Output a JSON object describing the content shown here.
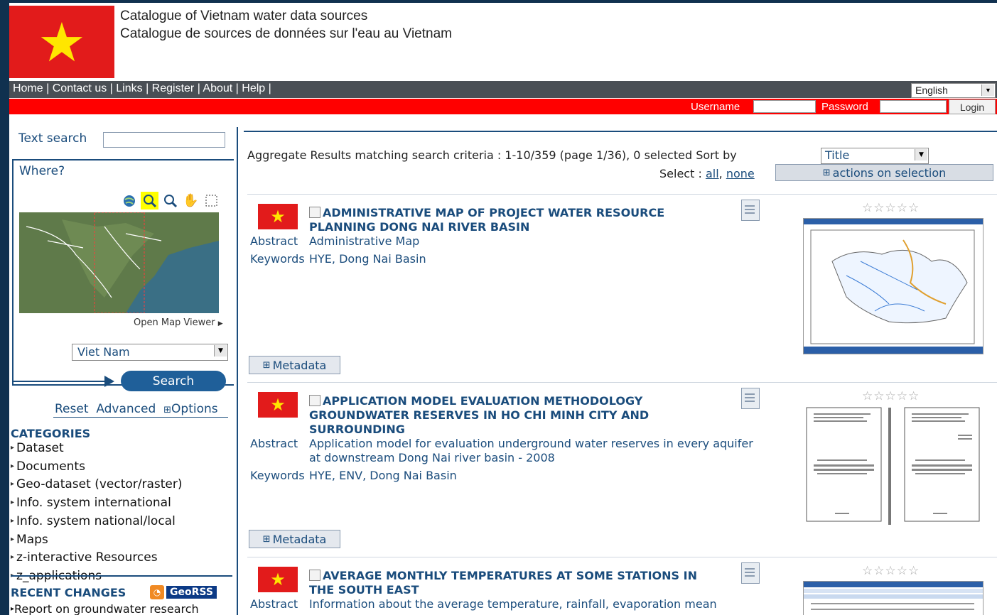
{
  "header": {
    "title_en": "Catalogue of Vietnam water data sources",
    "title_fr": "Catalogue de sources de données sur l'eau au Vietnam"
  },
  "nav": {
    "links": [
      "Home",
      "Contact us",
      "Links",
      "Register",
      "About",
      "Help"
    ],
    "language": "English"
  },
  "login": {
    "username_label": "Username",
    "password_label": "Password",
    "login_label": "Login"
  },
  "sidebar": {
    "text_search_label": "Text search",
    "where_label": "Where?",
    "open_map_viewer": "Open Map Viewer",
    "region_value": "Viet Nam",
    "search_label": "Search",
    "reset_label": "Reset",
    "advanced_label": "Advanced",
    "options_label": "Options",
    "categories_title": "CATEGORIES",
    "categories": [
      "Dataset",
      "Documents",
      "Geo-dataset (vector/raster)",
      "Info. system international",
      "Info. system national/local",
      "Maps",
      "z-interactive Resources",
      "z_applications"
    ],
    "recent_title": "RECENT CHANGES",
    "georss_label": "GeoRSS",
    "recent_item": "Report on groundwater research"
  },
  "results": {
    "aggregate_text": "Aggregate Results matching search criteria :   1-10/359   (page 1/36),   0 selected  Sort by",
    "sort_value": "Title",
    "select_label": "Select :",
    "select_all": "all",
    "select_none": "none",
    "actions_label": "actions on selection",
    "abstract_label": "Abstract",
    "keywords_label": "Keywords",
    "metadata_label": "Metadata",
    "items": [
      {
        "title": "ADMINISTRATIVE MAP OF PROJECT WATER RESOURCE PLANNING DONG NAI RIVER BASIN",
        "abstract": "Administrative Map",
        "keywords": "HYE, Dong Nai Basin",
        "stars": "☆☆☆☆☆"
      },
      {
        "title": "APPLICATION MODEL EVALUATION METHODOLOGY GROUNDWATER RESERVES IN HO CHI MINH CITY AND SURROUNDING",
        "abstract": "Application model for evaluation underground water reserves in every aquifer at downstream Dong Nai river basin - 2008",
        "keywords": "HYE, ENV, Dong Nai Basin",
        "stars": "☆☆☆☆☆"
      },
      {
        "title": "AVERAGE MONTHLY TEMPERATURES AT SOME STATIONS IN THE SOUTH EAST",
        "abstract": "Information about the average temperature, rainfall, evaporation mean",
        "stars": "☆☆☆☆☆"
      }
    ]
  },
  "colors": {
    "flag_red": "#e21b1b",
    "flag_star": "#ffe600",
    "accent_blue": "#1a4c7c",
    "login_bar_red": "#ff0000"
  }
}
